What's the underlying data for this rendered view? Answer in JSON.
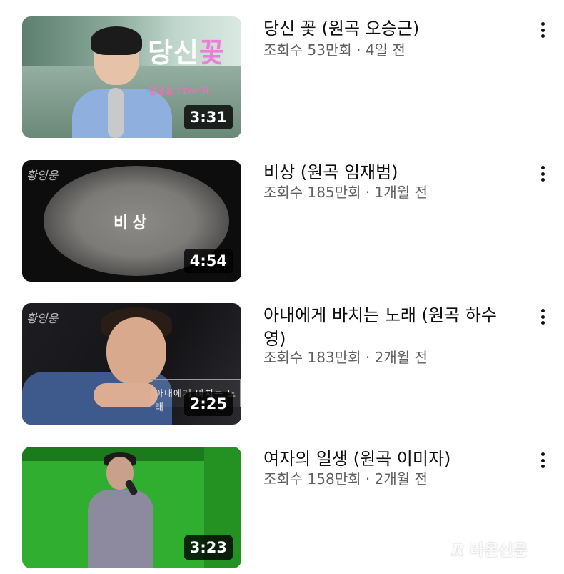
{
  "videos": [
    {
      "title": "당신 꽃 (원곡 오승근)",
      "meta": "조회수 53만회 · 4일 전",
      "duration": "3:31",
      "thumb_text": "당신",
      "thumb_text_accent": "꽃",
      "thumb_subtext": "-황영웅 COVER-"
    },
    {
      "title": "비상 (원곡 임재범)",
      "meta": "조회수 185만회 · 1개월 전",
      "duration": "4:54",
      "thumb_text": "비상"
    },
    {
      "title": "아내에게 바치는 노래 (원곡 하수영)",
      "meta": "조회수 183만회 · 2개월 전",
      "duration": "2:25",
      "thumb_text": "아내에게 바치는 노래"
    },
    {
      "title": "여자의 일생 (원곡 이미자)",
      "meta": "조회수 158만회 · 2개월 전",
      "duration": "3:23"
    }
  ],
  "watermark": "라온신문",
  "menu_icon": "more-vert-icon",
  "colors": {
    "title": "#0f0f0f",
    "meta": "#606060",
    "badge_bg": "#000000",
    "chroma_green": "#2fae2f"
  }
}
